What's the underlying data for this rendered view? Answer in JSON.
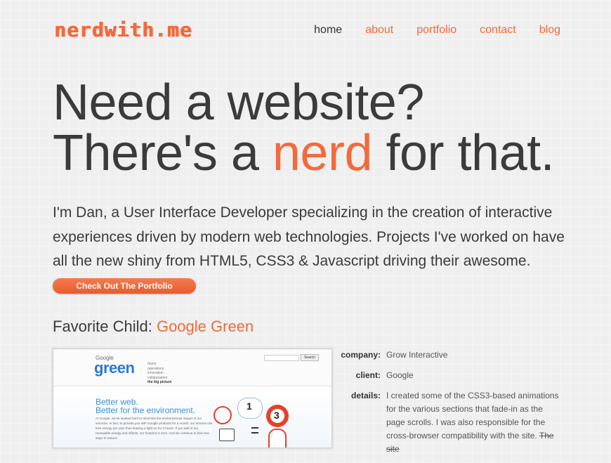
{
  "logo": "nerdwith.me",
  "nav": [
    "home",
    "about",
    "portfolio",
    "contact",
    "blog"
  ],
  "colors": {
    "accent": "#f26a3d",
    "text": "#3a3a3a",
    "background": "#efefef"
  },
  "hero": {
    "line1": "Need a website?",
    "line2_before": "There's a ",
    "line2_accent": "nerd",
    "line2_after": " for that."
  },
  "intro": "I'm Dan, a User Interface Developer specializing in the creation of interactive experiences driven by modern web technologies. Projects I've worked on have all the new shiny from HTML5, CSS3 & Javascript driving their awesome.",
  "cta": "Check Out The Portfolio",
  "favorite": {
    "prefix": "Favorite Child: ",
    "name": "Google Green"
  },
  "screenshot": {
    "google": "Google",
    "green": "green",
    "menu": [
      "home",
      "operations",
      "innovation",
      "collaboration",
      "the big picture"
    ],
    "search_button": "Search",
    "headline1": "Better web.",
    "headline2": "Better for the environment.",
    "paragraph": "At Google, we've worked hard to minimize the environmental impact of our services. In fact, to provide you with Google products for a month, our servers use less energy per user than leaving a light on for 3 hours. If you add in our renewable energy and offsets, our footprint is zero. And we continue to find new ways to reduce",
    "num1": "1",
    "num3": "3"
  },
  "details": {
    "company_label": "company:",
    "company": "Grow Interactive",
    "client_label": "client:",
    "client": "Google",
    "details_label": "details:",
    "details_text": "I created some of the CSS3-based animations for the various sections that fade-in as the page scrolls. I was also responsible for the cross-browser compatibility with the site.",
    "details_strike": "The site"
  }
}
